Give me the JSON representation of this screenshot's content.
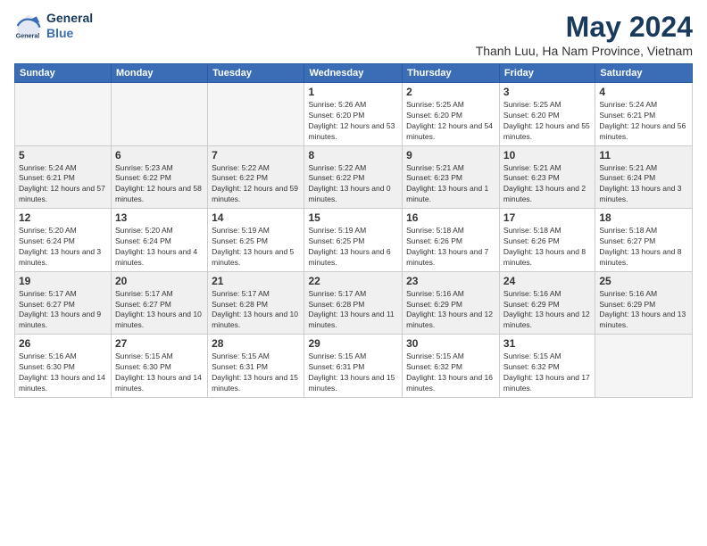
{
  "logo": {
    "line1": "General",
    "line2": "Blue"
  },
  "title": "May 2024",
  "subtitle": "Thanh Luu, Ha Nam Province, Vietnam",
  "days_of_week": [
    "Sunday",
    "Monday",
    "Tuesday",
    "Wednesday",
    "Thursday",
    "Friday",
    "Saturday"
  ],
  "weeks": [
    {
      "days": [
        {
          "empty": true
        },
        {
          "empty": true
        },
        {
          "empty": true
        },
        {
          "num": "1",
          "sunrise": "5:26 AM",
          "sunset": "6:20 PM",
          "daylight": "12 hours and 53 minutes."
        },
        {
          "num": "2",
          "sunrise": "5:25 AM",
          "sunset": "6:20 PM",
          "daylight": "12 hours and 54 minutes."
        },
        {
          "num": "3",
          "sunrise": "5:25 AM",
          "sunset": "6:20 PM",
          "daylight": "12 hours and 55 minutes."
        },
        {
          "num": "4",
          "sunrise": "5:24 AM",
          "sunset": "6:21 PM",
          "daylight": "12 hours and 56 minutes."
        }
      ]
    },
    {
      "days": [
        {
          "num": "5",
          "sunrise": "5:24 AM",
          "sunset": "6:21 PM",
          "daylight": "12 hours and 57 minutes."
        },
        {
          "num": "6",
          "sunrise": "5:23 AM",
          "sunset": "6:22 PM",
          "daylight": "12 hours and 58 minutes."
        },
        {
          "num": "7",
          "sunrise": "5:22 AM",
          "sunset": "6:22 PM",
          "daylight": "12 hours and 59 minutes."
        },
        {
          "num": "8",
          "sunrise": "5:22 AM",
          "sunset": "6:22 PM",
          "daylight": "13 hours and 0 minutes."
        },
        {
          "num": "9",
          "sunrise": "5:21 AM",
          "sunset": "6:23 PM",
          "daylight": "13 hours and 1 minute."
        },
        {
          "num": "10",
          "sunrise": "5:21 AM",
          "sunset": "6:23 PM",
          "daylight": "13 hours and 2 minutes."
        },
        {
          "num": "11",
          "sunrise": "5:21 AM",
          "sunset": "6:24 PM",
          "daylight": "13 hours and 3 minutes."
        }
      ]
    },
    {
      "days": [
        {
          "num": "12",
          "sunrise": "5:20 AM",
          "sunset": "6:24 PM",
          "daylight": "13 hours and 3 minutes."
        },
        {
          "num": "13",
          "sunrise": "5:20 AM",
          "sunset": "6:24 PM",
          "daylight": "13 hours and 4 minutes."
        },
        {
          "num": "14",
          "sunrise": "5:19 AM",
          "sunset": "6:25 PM",
          "daylight": "13 hours and 5 minutes."
        },
        {
          "num": "15",
          "sunrise": "5:19 AM",
          "sunset": "6:25 PM",
          "daylight": "13 hours and 6 minutes."
        },
        {
          "num": "16",
          "sunrise": "5:18 AM",
          "sunset": "6:26 PM",
          "daylight": "13 hours and 7 minutes."
        },
        {
          "num": "17",
          "sunrise": "5:18 AM",
          "sunset": "6:26 PM",
          "daylight": "13 hours and 8 minutes."
        },
        {
          "num": "18",
          "sunrise": "5:18 AM",
          "sunset": "6:27 PM",
          "daylight": "13 hours and 8 minutes."
        }
      ]
    },
    {
      "days": [
        {
          "num": "19",
          "sunrise": "5:17 AM",
          "sunset": "6:27 PM",
          "daylight": "13 hours and 9 minutes."
        },
        {
          "num": "20",
          "sunrise": "5:17 AM",
          "sunset": "6:27 PM",
          "daylight": "13 hours and 10 minutes."
        },
        {
          "num": "21",
          "sunrise": "5:17 AM",
          "sunset": "6:28 PM",
          "daylight": "13 hours and 10 minutes."
        },
        {
          "num": "22",
          "sunrise": "5:17 AM",
          "sunset": "6:28 PM",
          "daylight": "13 hours and 11 minutes."
        },
        {
          "num": "23",
          "sunrise": "5:16 AM",
          "sunset": "6:29 PM",
          "daylight": "13 hours and 12 minutes."
        },
        {
          "num": "24",
          "sunrise": "5:16 AM",
          "sunset": "6:29 PM",
          "daylight": "13 hours and 12 minutes."
        },
        {
          "num": "25",
          "sunrise": "5:16 AM",
          "sunset": "6:29 PM",
          "daylight": "13 hours and 13 minutes."
        }
      ]
    },
    {
      "days": [
        {
          "num": "26",
          "sunrise": "5:16 AM",
          "sunset": "6:30 PM",
          "daylight": "13 hours and 14 minutes."
        },
        {
          "num": "27",
          "sunrise": "5:15 AM",
          "sunset": "6:30 PM",
          "daylight": "13 hours and 14 minutes."
        },
        {
          "num": "28",
          "sunrise": "5:15 AM",
          "sunset": "6:31 PM",
          "daylight": "13 hours and 15 minutes."
        },
        {
          "num": "29",
          "sunrise": "5:15 AM",
          "sunset": "6:31 PM",
          "daylight": "13 hours and 15 minutes."
        },
        {
          "num": "30",
          "sunrise": "5:15 AM",
          "sunset": "6:32 PM",
          "daylight": "13 hours and 16 minutes."
        },
        {
          "num": "31",
          "sunrise": "5:15 AM",
          "sunset": "6:32 PM",
          "daylight": "13 hours and 17 minutes."
        },
        {
          "empty": true
        }
      ]
    }
  ],
  "labels": {
    "sunrise": "Sunrise:",
    "sunset": "Sunset:",
    "daylight": "Daylight:"
  }
}
